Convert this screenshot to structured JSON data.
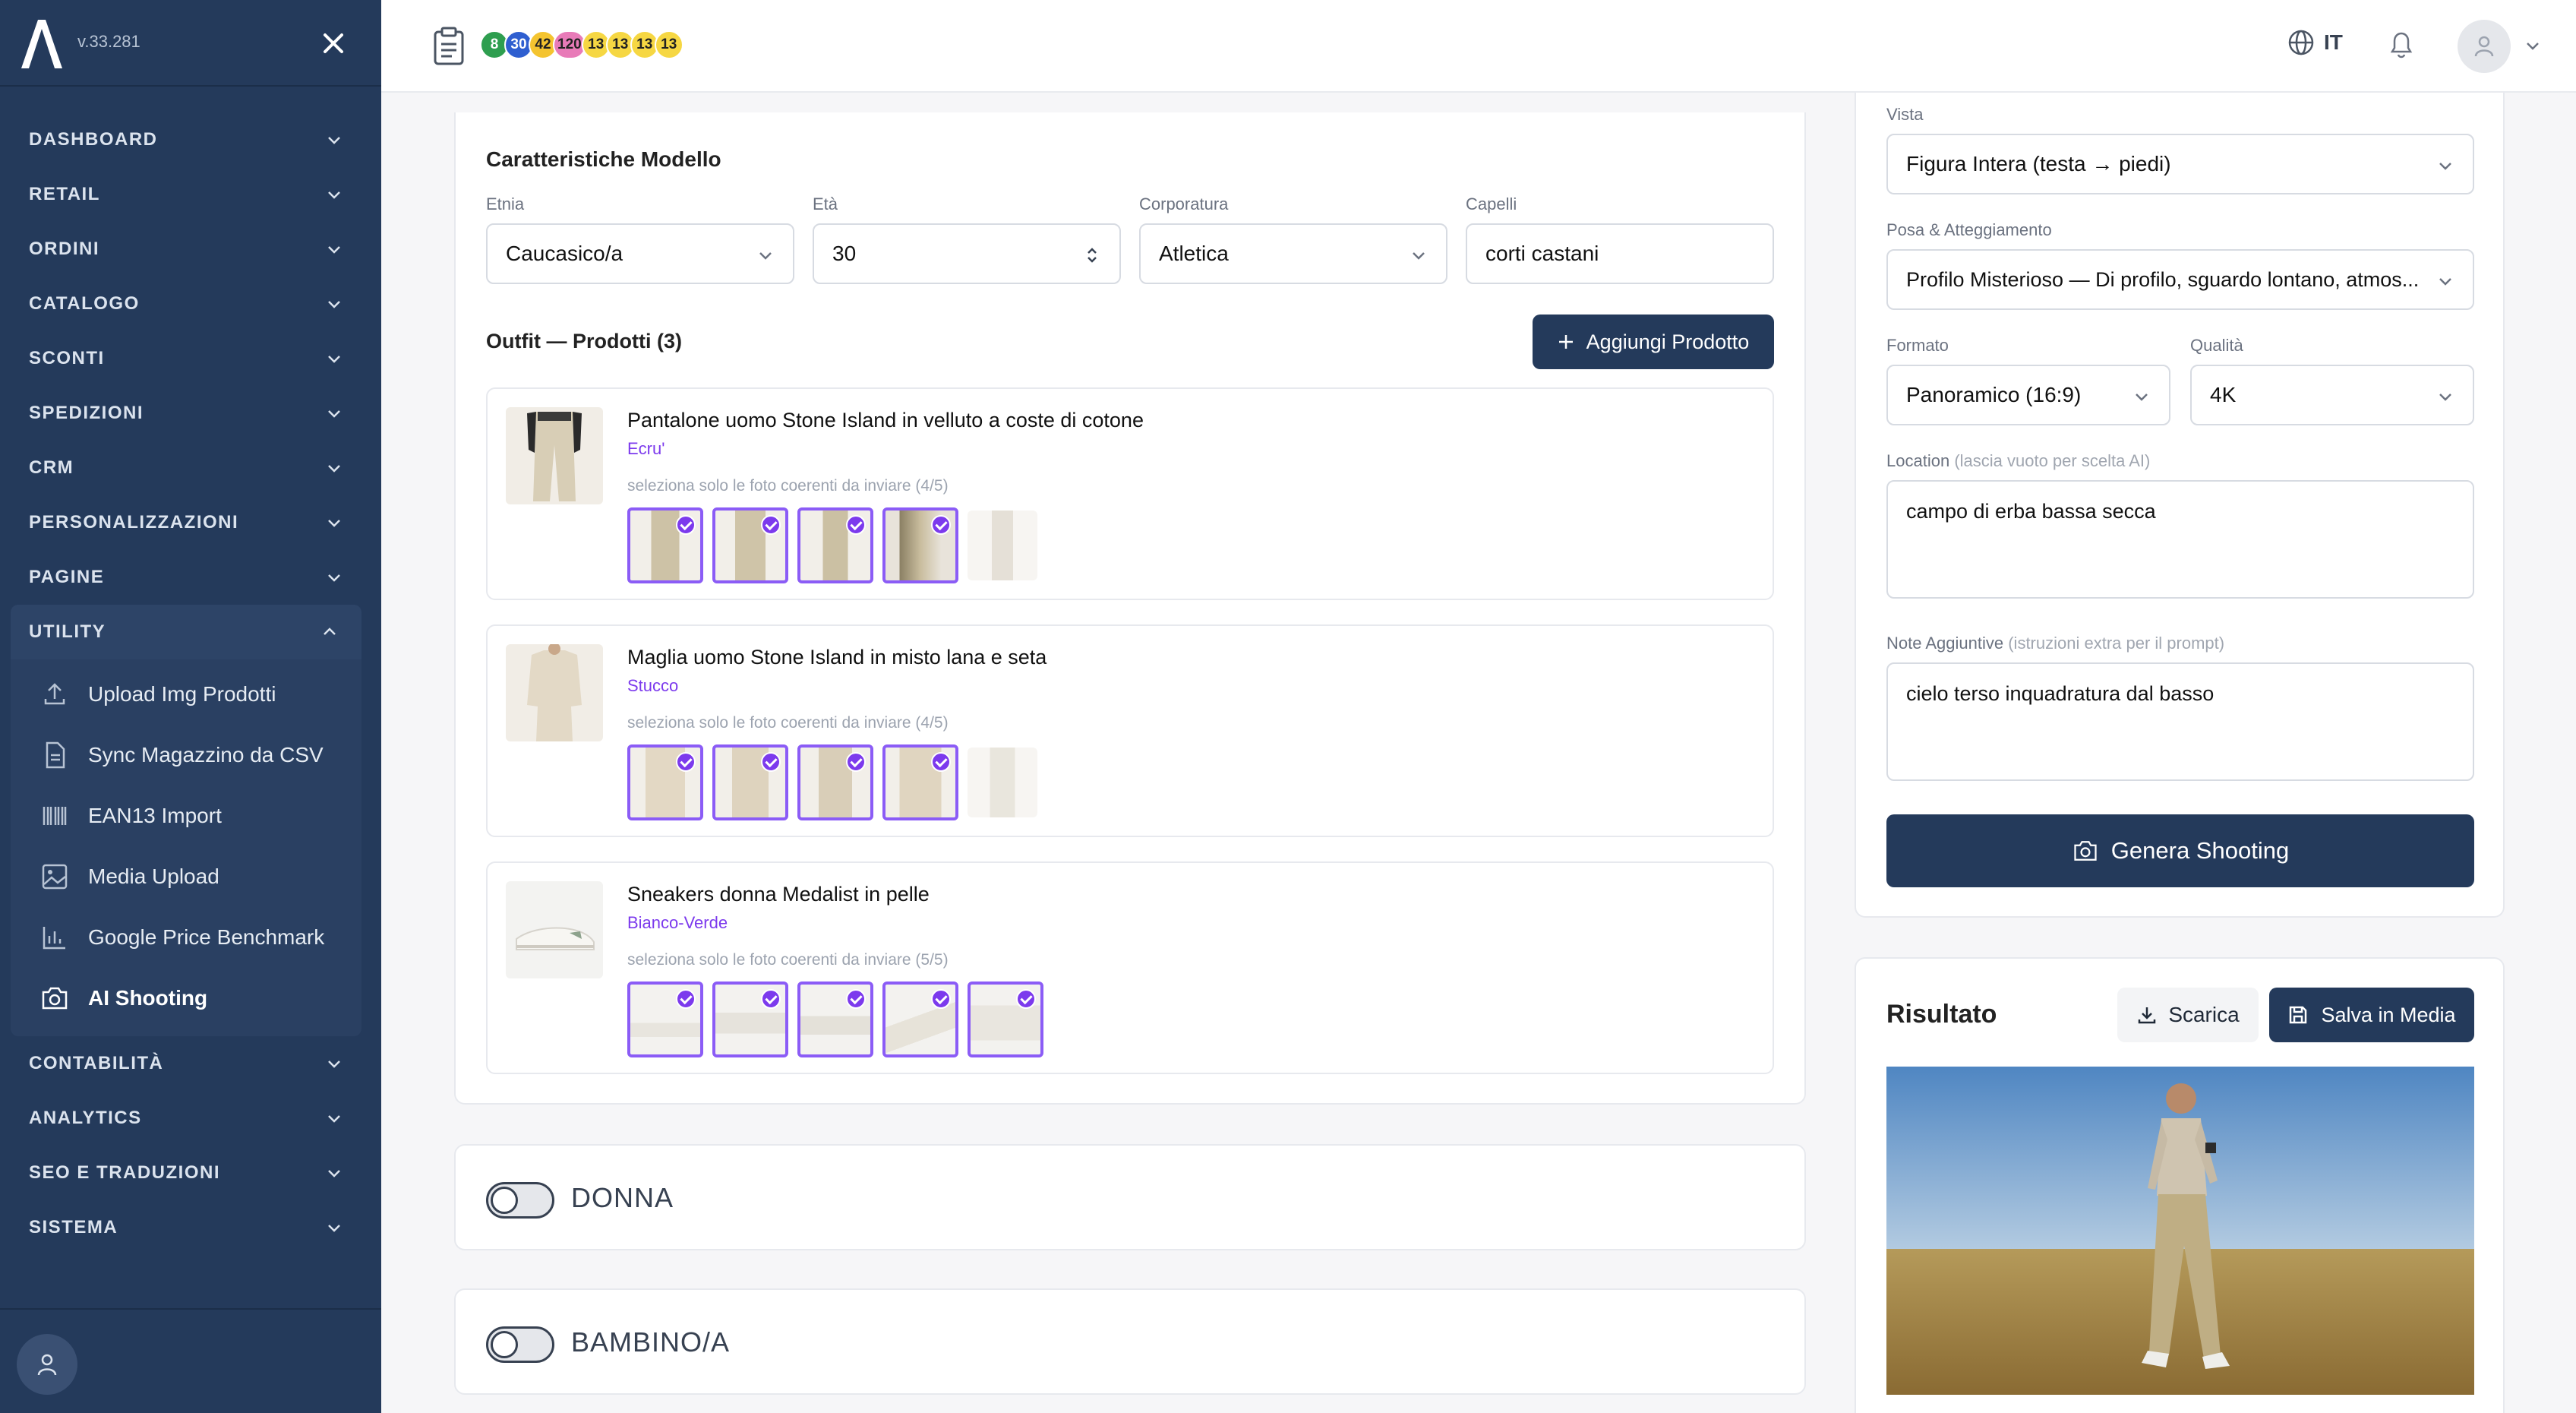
{
  "app": {
    "version": "v.33.281"
  },
  "sidebar": {
    "items": [
      "DASHBOARD",
      "RETAIL",
      "ORDINI",
      "CATALOGO",
      "SCONTI",
      "SPEDIZIONI",
      "CRM",
      "PERSONALIZZAZIONI",
      "PAGINE"
    ],
    "open": "UTILITY",
    "sub": [
      "Upload Img Prodotti",
      "Sync Magazzino da CSV",
      "EAN13 Import",
      "Media Upload",
      "Google Price Benchmark",
      "AI Shooting"
    ],
    "items_after": [
      "CONTABILITÀ",
      "ANALYTICS",
      "SEO E TRADUZIONI",
      "SISTEMA"
    ]
  },
  "topbar": {
    "badges": [
      {
        "t": "8",
        "c": "#2e9e4f"
      },
      {
        "t": "30",
        "c": "#2f5fd0"
      },
      {
        "t": "42",
        "c": "#f4c430"
      },
      {
        "t": "120",
        "c": "#e87bb8"
      },
      {
        "t": "13",
        "c": "#f6d743"
      },
      {
        "t": "13",
        "c": "#f6d743"
      },
      {
        "t": "13",
        "c": "#f6d743"
      },
      {
        "t": "13",
        "c": "#f6d743"
      }
    ],
    "lang": "IT"
  },
  "model": {
    "title": "Caratteristiche Modello",
    "etnia_label": "Etnia",
    "etnia": "Caucasico/a",
    "eta_label": "Età",
    "eta": "30",
    "corp_label": "Corporatura",
    "corp": "Atletica",
    "capelli_label": "Capelli",
    "capelli": "corti castani"
  },
  "outfit": {
    "title": "Outfit — Prodotti (3)",
    "add": "Aggiungi Prodotto",
    "products": [
      {
        "name": "Pantalone uomo Stone Island in velluto a coste di cotone",
        "color": "Ecru'",
        "hint": "seleziona solo le foto coerenti da inviare (4/5)"
      },
      {
        "name": "Maglia uomo Stone Island in misto lana e seta",
        "color": "Stucco",
        "hint": "seleziona solo le foto coerenti da inviare (4/5)"
      },
      {
        "name": "Sneakers donna Medalist in pelle",
        "color": "Bianco-Verde",
        "hint": "seleziona solo le foto coerenti da inviare (5/5)"
      }
    ]
  },
  "toggles": {
    "donna": "DONNA",
    "bambino": "BAMBINO/A"
  },
  "settings": {
    "vista_label": "Vista",
    "vista": "Figura Intera (testa → piedi)",
    "posa_label": "Posa & Atteggiamento",
    "posa": "Profilo Misterioso — Di profilo, sguardo lontano, atmos...",
    "formato_label": "Formato",
    "formato": "Panoramico (16:9)",
    "qualita_label": "Qualità",
    "qualita": "4K",
    "location_label": "Location",
    "location_hint": "(lascia vuoto per scelta AI)",
    "location": "campo di erba bassa secca",
    "note_label": "Note Aggiuntive",
    "note_hint": "(istruzioni extra per il prompt)",
    "note": "cielo terso inquadratura dal basso",
    "genera": "Genera Shooting"
  },
  "result": {
    "title": "Risultato",
    "scarica": "Scarica",
    "salva": "Salva in Media"
  }
}
